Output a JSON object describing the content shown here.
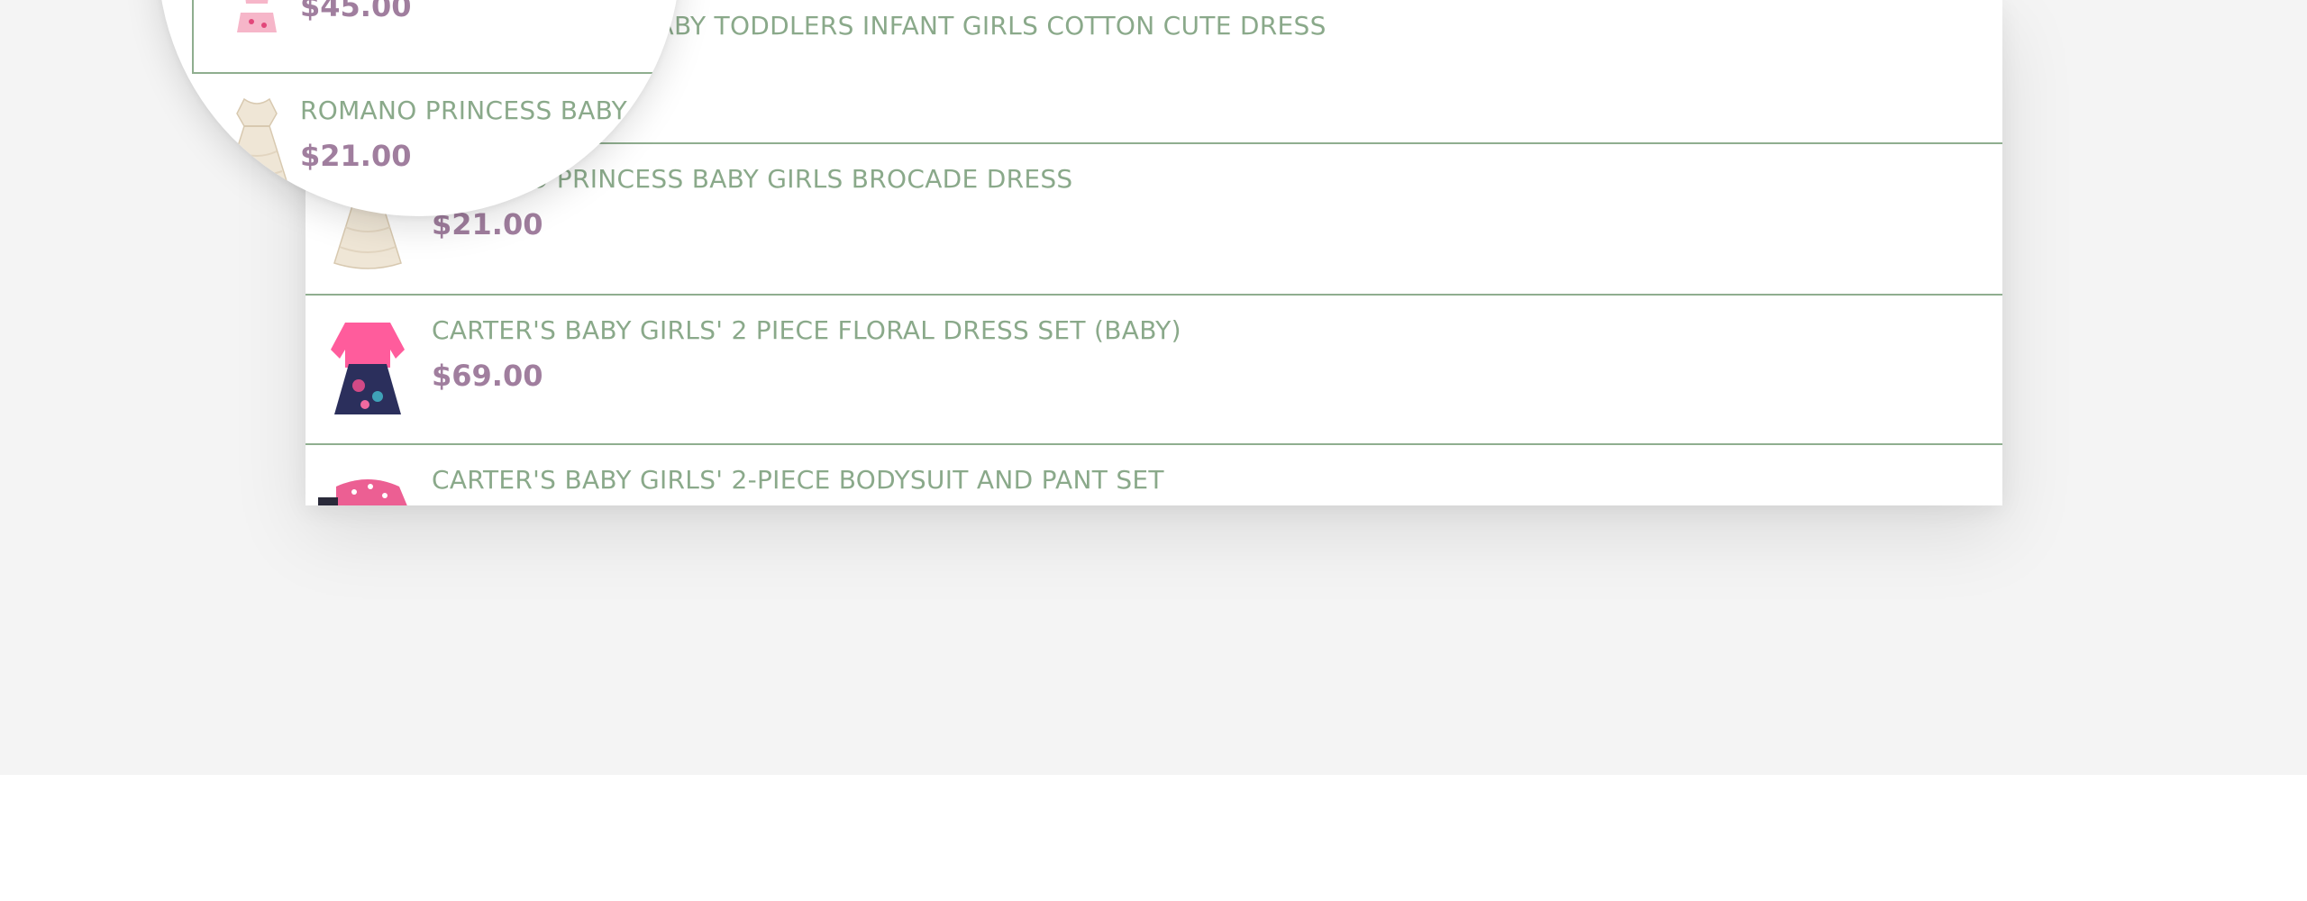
{
  "results": [
    {
      "title": "BABY TODDLERS INFANT GIRLS COTTON CUTE DRESS",
      "price": "",
      "image": "floral-dress-thumbnail"
    },
    {
      "title": "ROMANO PRINCESS BABY GIRLS BROCADE DRESS",
      "price": "$21.00",
      "image": "cream-brocade-dress-thumbnail"
    },
    {
      "title": "CARTER'S BABY GIRLS' 2 PIECE FLORAL DRESS SET (BABY)",
      "price": "$69.00",
      "image": "pink-cardigan-navy-floral-dress-thumbnail"
    },
    {
      "title": "CARTER'S BABY GIRLS' 2-PIECE BODYSUIT AND PANT SET",
      "price": "",
      "image": "pink-polka-dot-bodysuit-thumbnail"
    }
  ],
  "magnifier": {
    "rows": [
      {
        "title": "",
        "price": "$45.00",
        "image": "pink-floral-outfit-thumbnail"
      },
      {
        "title": "ROMANO PRINCESS BABY G",
        "price": "$21.00",
        "image": "cream-brocade-dress-thumbnail"
      }
    ]
  },
  "colors": {
    "title_green": "#8aa98a",
    "price_mauve": "#a07e9e",
    "divider_green": "#8fae8f",
    "page_background": "#f4f4f4"
  }
}
